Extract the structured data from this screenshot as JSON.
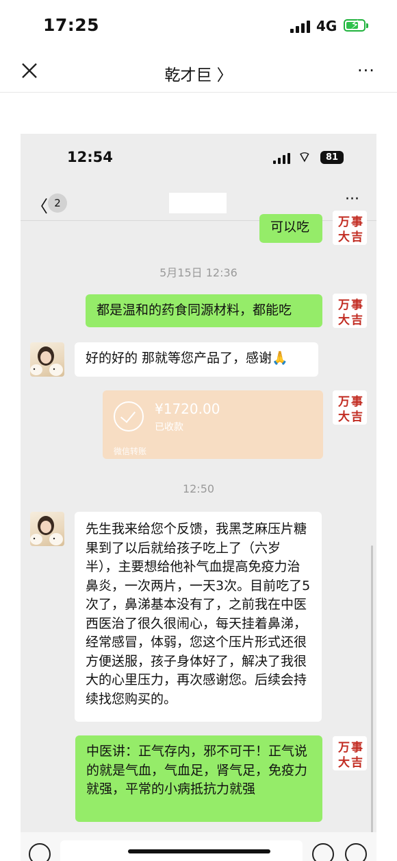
{
  "status_bar": {
    "time": "17:25",
    "network": "4G"
  },
  "nav": {
    "title": "乾才巨 〉",
    "more": "···"
  },
  "inner_status": {
    "time": "12:54",
    "battery": "81"
  },
  "inner_nav": {
    "unread": "2",
    "more": "···"
  },
  "stamp_text": [
    "万",
    "事",
    "大",
    "吉"
  ],
  "messages": [
    {
      "text": "可以吃"
    },
    {
      "text": "都是温和的药食同源材料，都能吃"
    },
    {
      "text": "好的好的 那就等您产品了，感谢🙏"
    },
    {
      "text": "先生我来给您个反馈，我黑芝麻压片糖果到了以后就给孩子吃上了（六岁半），主要想给他补气血提高免疫力治鼻炎，一次两片，一天3次。目前吃了5次了，鼻涕基本没有了，之前我在中医西医治了很久很闹心，每天挂着鼻涕，经常感冒，体弱，您这个压片形式还很方便送服，孩子身体好了，解决了我很大的心里压力，再次感谢您。后续会持续找您购买的。"
    },
    {
      "text": "中医讲：正气存内，邪不可干！正气说的就是气血，气血足，肾气足，免疫力就强，平常的小病抵抗力就强"
    }
  ],
  "timestamps": [
    "5月15日 12:36",
    "12:50"
  ],
  "transfer": {
    "amount": "¥1720.00",
    "status": "已收款",
    "footer": "微信转账"
  }
}
